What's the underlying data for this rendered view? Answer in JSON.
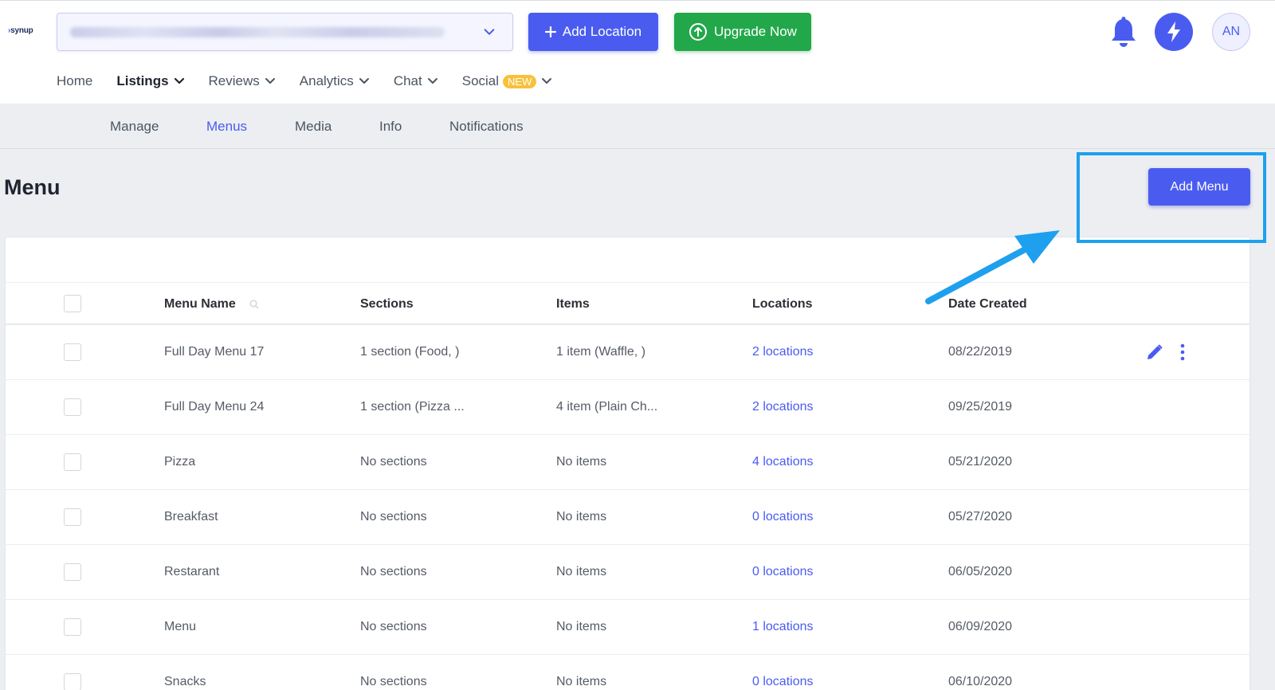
{
  "header": {
    "logo_text": "synup",
    "add_location_label": "Add Location",
    "upgrade_label": "Upgrade Now",
    "avatar_initials": "AN",
    "accent_color": "#4a5cf0",
    "upgrade_color": "#22a84a"
  },
  "main_nav": {
    "items": [
      {
        "label": "Home",
        "active": false,
        "has_dropdown": false
      },
      {
        "label": "Listings",
        "active": true,
        "has_dropdown": true
      },
      {
        "label": "Reviews",
        "active": false,
        "has_dropdown": true
      },
      {
        "label": "Analytics",
        "active": false,
        "has_dropdown": true
      },
      {
        "label": "Chat",
        "active": false,
        "has_dropdown": true
      },
      {
        "label": "Social",
        "active": false,
        "has_dropdown": true,
        "badge": "NEW"
      }
    ]
  },
  "sub_nav": {
    "tabs": [
      {
        "label": "Manage",
        "active": false
      },
      {
        "label": "Menus",
        "active": true
      },
      {
        "label": "Media",
        "active": false
      },
      {
        "label": "Info",
        "active": false
      },
      {
        "label": "Notifications",
        "active": false
      }
    ]
  },
  "page": {
    "title": "Menu",
    "add_menu_label": "Add Menu"
  },
  "table": {
    "columns": [
      "Menu Name",
      "Sections",
      "Items",
      "Locations",
      "Date Created"
    ],
    "rows": [
      {
        "name": "Full Day Menu 17",
        "sections": "1 section (Food, )",
        "items": "1 item (Waffle, )",
        "locations": "2 locations",
        "date": "08/22/2019"
      },
      {
        "name": "Full Day Menu 24",
        "sections": "1 section (Pizza ...",
        "items": "4 item (Plain Ch...",
        "locations": "2 locations",
        "date": "09/25/2019"
      },
      {
        "name": "Pizza",
        "sections": "No sections",
        "items": "No items",
        "locations": "4 locations",
        "date": "05/21/2020"
      },
      {
        "name": "Breakfast",
        "sections": "No sections",
        "items": "No items",
        "locations": "0 locations",
        "date": "05/27/2020"
      },
      {
        "name": "Restarant",
        "sections": "No sections",
        "items": "No items",
        "locations": "0 locations",
        "date": "06/05/2020"
      },
      {
        "name": "Menu",
        "sections": "No sections",
        "items": "No items",
        "locations": "1 locations",
        "date": "06/09/2020"
      },
      {
        "name": "Snacks",
        "sections": "No sections",
        "items": "No items",
        "locations": "0 locations",
        "date": "06/10/2020"
      }
    ]
  },
  "annotation": {
    "highlight_color": "#1ea0ee"
  }
}
